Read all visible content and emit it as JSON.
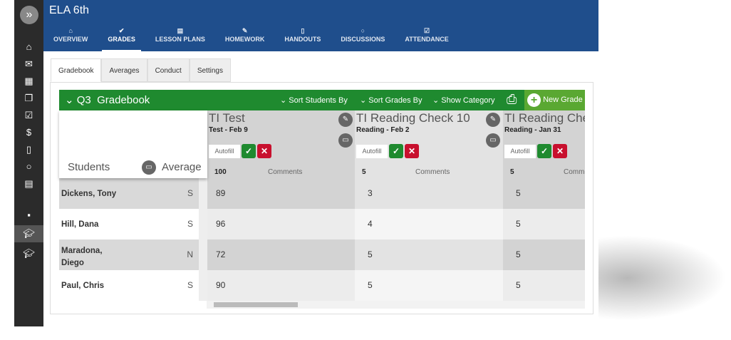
{
  "header": {
    "title": "ELA 6th"
  },
  "nav": [
    {
      "label": "OVERVIEW",
      "icon": "⌂"
    },
    {
      "label": "GRADES",
      "icon": "✔"
    },
    {
      "label": "LESSON PLANS",
      "icon": "▤"
    },
    {
      "label": "HOMEWORK",
      "icon": "✎"
    },
    {
      "label": "HANDOUTS",
      "icon": "▯"
    },
    {
      "label": "DISCUSSIONS",
      "icon": "○"
    },
    {
      "label": "ATTENDANCE",
      "icon": "☑"
    }
  ],
  "tabs": [
    "Gradebook",
    "Averages",
    "Conduct",
    "Settings"
  ],
  "gradebook": {
    "title": "Q3  Gradebook",
    "sort_students": "Sort Students By",
    "sort_grades": "Sort Grades By",
    "show_category": "Show Category",
    "new_grade": "New Grade",
    "students_label": "Students",
    "average_label": "Average"
  },
  "columns": [
    {
      "name": "TI Test",
      "sub": "Test - Feb 9",
      "autofill": "Autofill",
      "max": "100",
      "comments": "Comments"
    },
    {
      "name": "TI Reading Check 10",
      "sub": "Reading - Feb 2",
      "autofill": "Autofill",
      "max": "5",
      "comments": "Comments"
    },
    {
      "name": "TI Reading Check",
      "sub": "Reading - Jan 31",
      "autofill": "Autofill",
      "max": "5",
      "comments": "Comments"
    }
  ],
  "rows": [
    {
      "name": "Dickens, Tony",
      "avg": "S",
      "grades": [
        "89",
        "3",
        "5"
      ]
    },
    {
      "name": "Hill, Dana",
      "avg": "S",
      "grades": [
        "96",
        "4",
        "5"
      ]
    },
    {
      "name": "Maradona, Diego",
      "avg": "N",
      "grades": [
        "72",
        "5",
        "5"
      ]
    },
    {
      "name": "Paul, Chris",
      "avg": "S",
      "grades": [
        "90",
        "5",
        "5"
      ]
    }
  ]
}
